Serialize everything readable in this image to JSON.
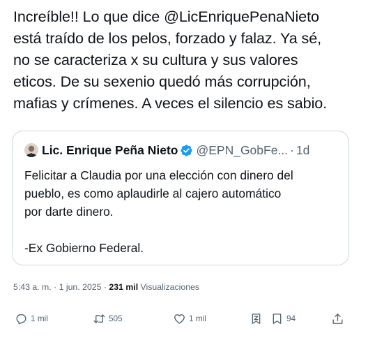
{
  "tweet": {
    "lines": [
      "Increíble!! Lo que dice @LicEnriquePenaNieto",
      "está traído de los pelos, forzado y falaz. Ya sé,",
      "no se caracteriza x su cultura y sus valores",
      "eticos. De su sexenio quedó más corrupción,",
      "mafias y crímenes. A veces el silencio es sabio."
    ]
  },
  "quote": {
    "name": "Lic. Enrique Peña Nieto",
    "handle": "@EPN_GobFe...",
    "separator": "·",
    "time": "1d",
    "lines": [
      "Felicitar a Claudia por una elección con dinero del",
      "pueblo, es como aplaudirle al cajero automático",
      "por darte dinero.",
      "",
      "-Ex Gobierno Federal."
    ],
    "verified_color": "#1d9bf0"
  },
  "meta": {
    "timestamp": "5:43 a. m. · 1 jun. 2025 · ",
    "views_count": "231 mil",
    "views_label": " Visualizaciones"
  },
  "actions": {
    "reply_count": "1 mil",
    "retweet_count": "505",
    "like_count": "1 mil",
    "bookmark_count": "94",
    "icons": [
      "reply-icon",
      "retweet-icon",
      "like-icon",
      "grok-icon",
      "bookmark-icon",
      "share-icon"
    ]
  },
  "colors": {
    "text": "#0f1419",
    "secondary": "#536471",
    "border": "#cfd9de",
    "accent": "#1d9bf0"
  }
}
